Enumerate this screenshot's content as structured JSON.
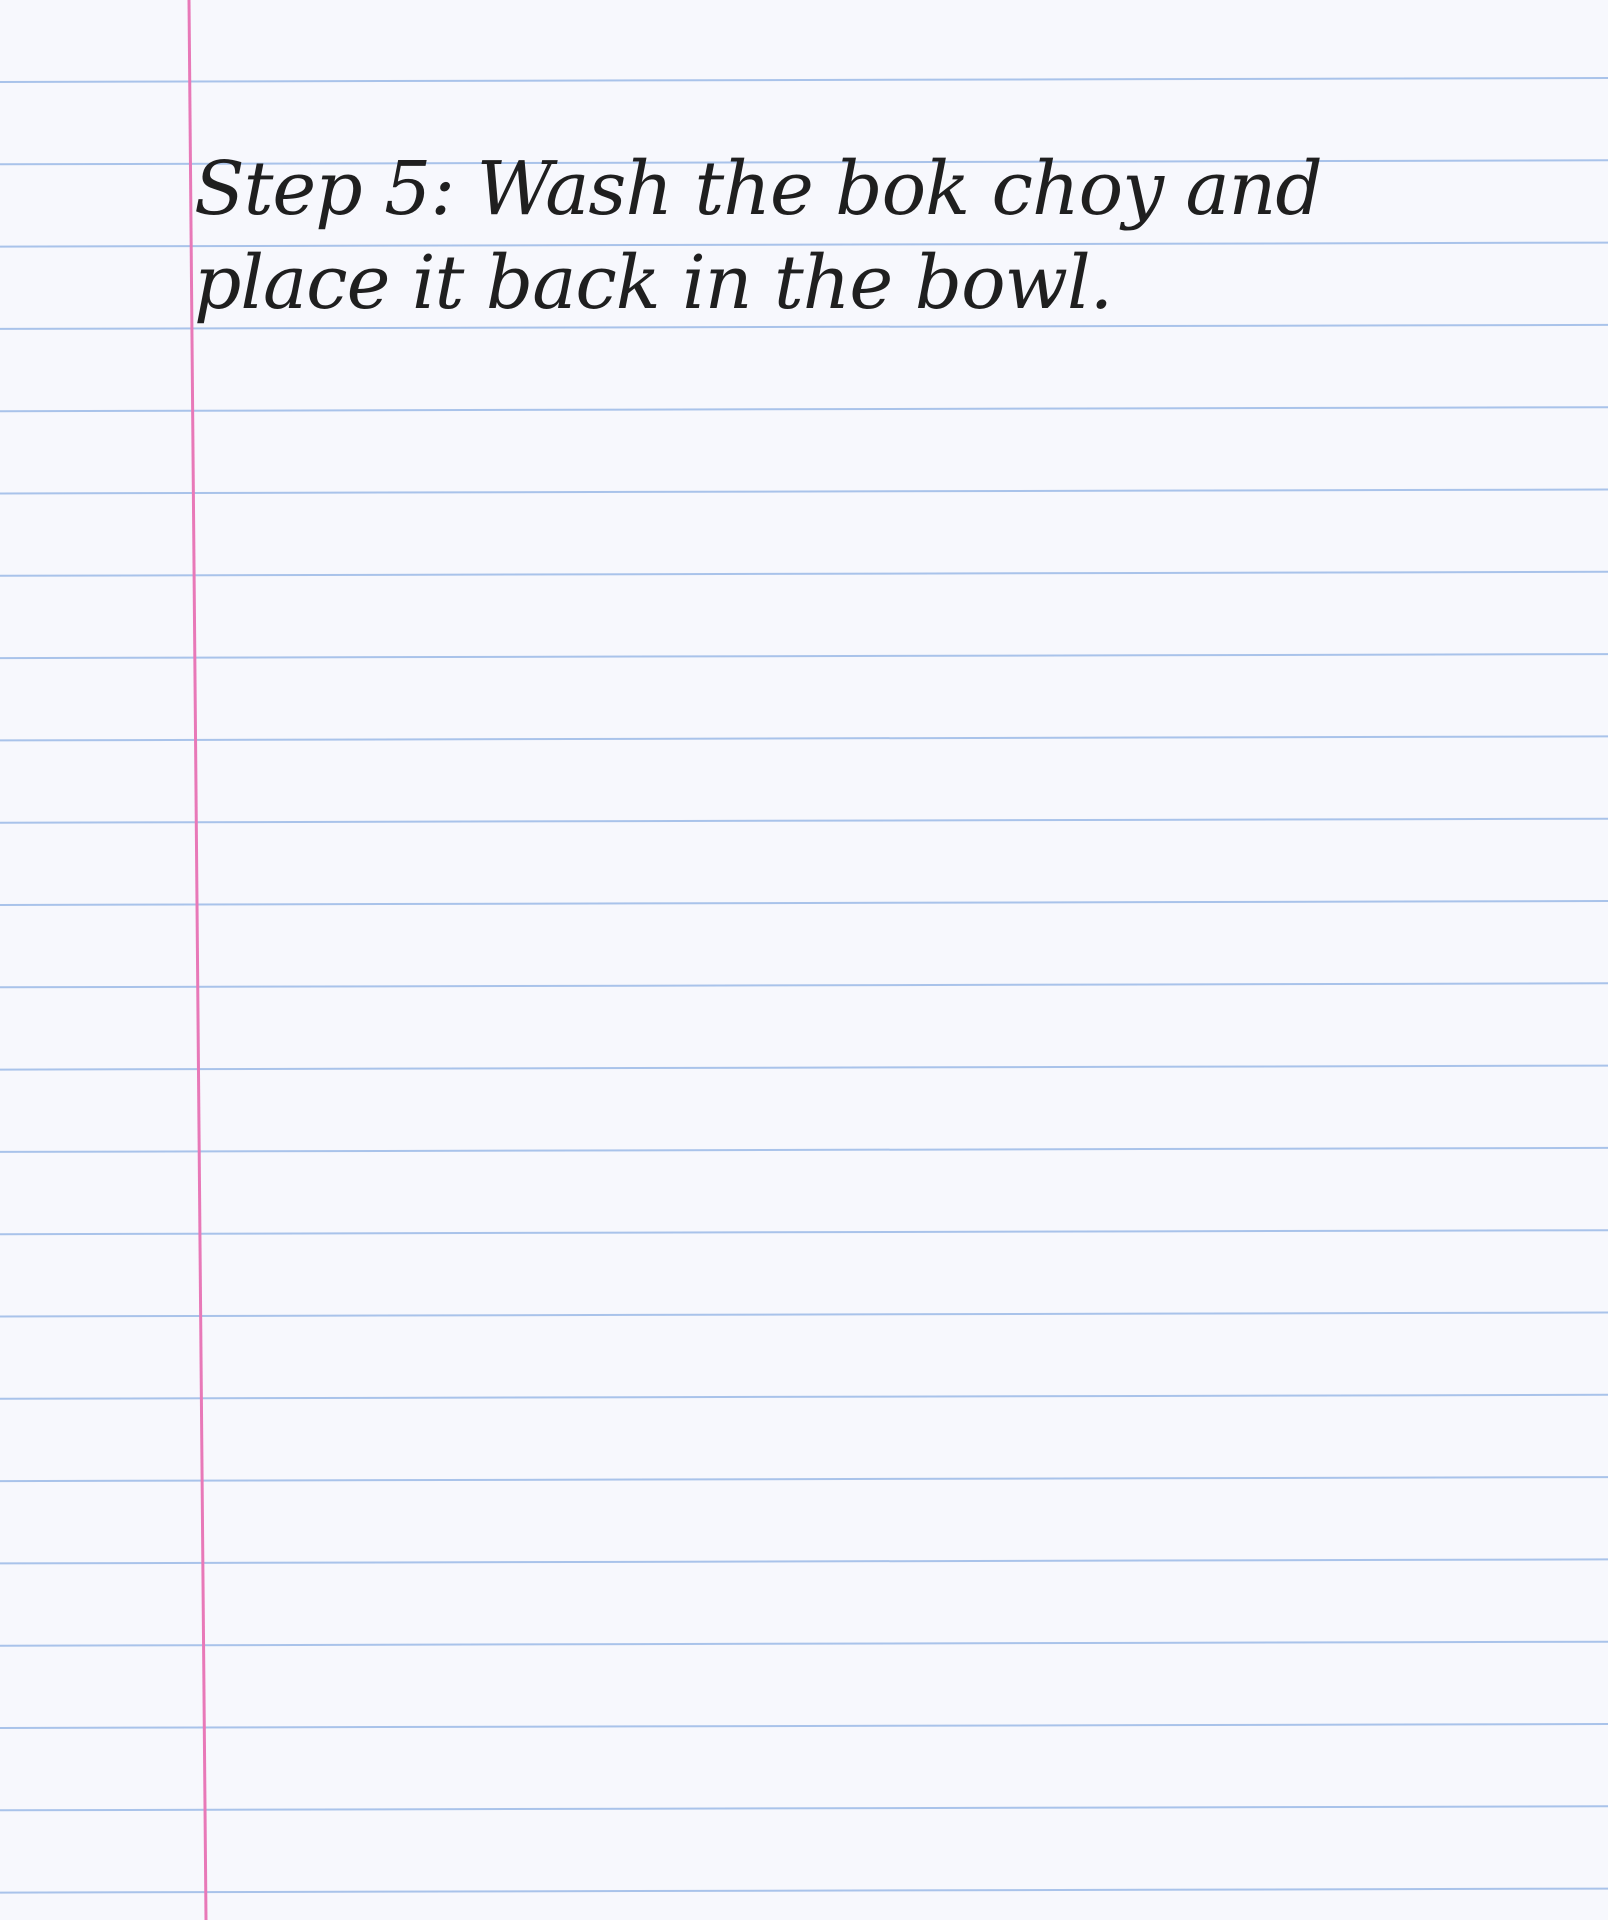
{
  "paper": {
    "background": "#f7f8fd",
    "rule_color": "#a9c3ea",
    "margin_color": "#e879b8",
    "ink_color": "#1f1f1f"
  },
  "note": {
    "lines": [
      "Step 5: Wash the bok choy and",
      "place it back in the bowl."
    ]
  }
}
